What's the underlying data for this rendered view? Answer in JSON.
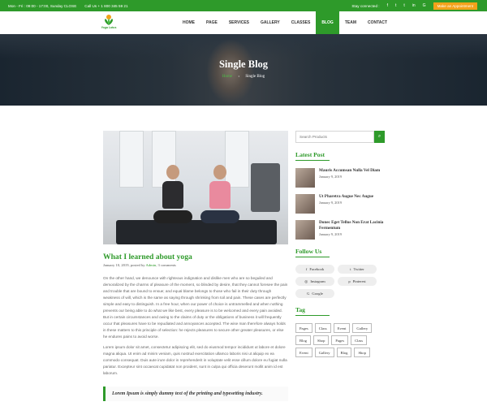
{
  "topbar": {
    "hours": "Mon - Fri : 09:00 - 17:00, Sunday CLOSE",
    "phone": "Call Us + 1 800 345 59 21",
    "connect_label": "Stay connected :",
    "social": [
      "f",
      "t",
      "t",
      "in",
      "G"
    ],
    "appointment": "Make an Appointment"
  },
  "logo": {
    "text": "Yoga Lotus"
  },
  "nav": [
    "HOME",
    "PAGE",
    "SERVICES",
    "GALLERY",
    "CLASSES",
    "BLOG",
    "TEAM",
    "CONTACT"
  ],
  "hero": {
    "title": "Single Blog",
    "crumb_home": "Home",
    "crumb_current": "Single Blog",
    "crumb_sep": "›"
  },
  "post": {
    "title": "What I learned about yoga",
    "meta_date": "January 10, 2019, posted by",
    "meta_author": "Admin",
    "meta_comments": ", 3 comments",
    "para1": "On the other hand, we denounce with righteous indignation and dislike men who are so beguiled and demoralized by the charms of pleasure of the moment, so blinded by desire, that they cannot foresee the pain and trouble that are bound to ensue; and equal blame belongs to those who fail in their duty through weakness of will, which is the same as saying through shrinking from toil and pain. These cases are perfectly simple and easy to distinguish. In a free hour, when our power of choice is untrammelled and when nothing prevents our being able to do what we like best, every pleasure is to be welcomed and every pain avoided. But in certain circumstances and owing to the claims of duty or the obligations of business it will frequently occur that pleasures have to be repudiated and annoyances accepted. The wise man therefore always holds in these matters to this principle of selection: he rejects pleasures to secure other greater pleasures, or else he endures pains to avoid worse.",
    "para2": "Lorem ipsum dolor sit amet, consectetur adipiscing elit, sed do eiusmod tempor incididunt ut labore et dolore magna aliqua. Ut enim ad minim veniam, quis nostrud exercitation ullamco laboris nisi ut aliquip ex ea commodo consequat. Duis aute irure dolor in reprehenderit in voluptate velit esse cillum dolore eu fugiat nulla pariatur. Excepteur sint occaecat cupidatat non proident, sunt in culpa qui officia deserunt mollit anim id est laborum.",
    "quote": "Lorem Ipsum is simply dummy text of the printing and typesetting industry."
  },
  "sidebar": {
    "search_placeholder": "Search Products",
    "latest_title": "Latest Post",
    "latest": [
      {
        "title": "Mauris Accumsan Nulla Vel Diam",
        "date": "January 9, 2019"
      },
      {
        "title": "Ut Pharetra Augue Nec Augue",
        "date": "January 9, 2019"
      },
      {
        "title": "Donec Eget Tellus Non Erat Lacinia Fermentum",
        "date": "January 9, 2019"
      }
    ],
    "follow_title": "Follow Us",
    "follow": [
      {
        "icon": "f",
        "label": "Facebook"
      },
      {
        "icon": "t",
        "label": "Twitter"
      },
      {
        "icon": "◎",
        "label": "Instagram"
      },
      {
        "icon": "p",
        "label": "Pinterest"
      },
      {
        "icon": "G",
        "label": "Google"
      }
    ],
    "tag_title": "Tag",
    "tags": [
      "Pages",
      "Class",
      "Event",
      "Gallery",
      "Blog",
      "Shop",
      "Pages",
      "Class",
      "Event",
      "Gallery",
      "Blog",
      "Shop"
    ]
  },
  "colors": {
    "accent": "#2e9a2a",
    "appointment": "#f2a21a"
  }
}
